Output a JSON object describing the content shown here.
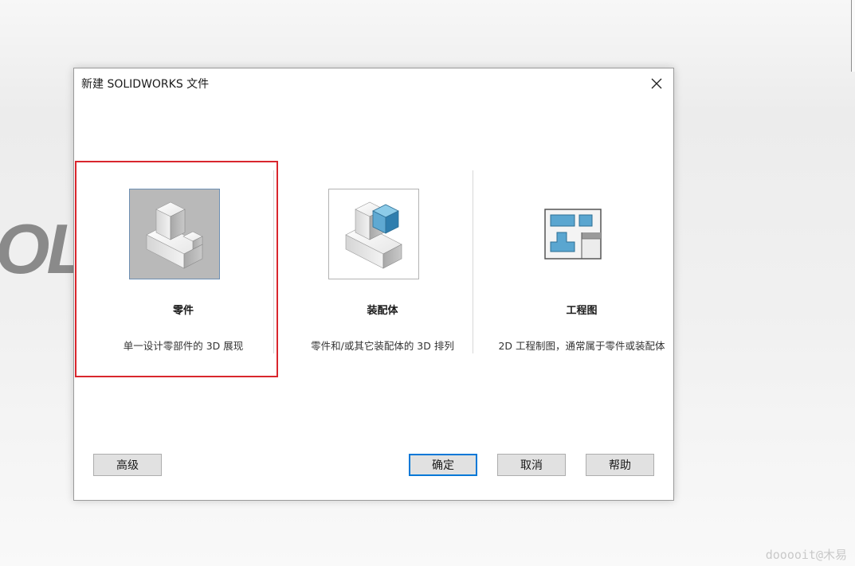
{
  "background": {
    "logo_text": "OL",
    "watermark": "dooooit@木易"
  },
  "dialog": {
    "title": "新建 SOLIDWORKS 文件",
    "options": [
      {
        "label": "零件",
        "description": "单一设计零部件的 3D 展现",
        "selected": true,
        "icon": "part-icon"
      },
      {
        "label": "装配体",
        "description": "零件和/或其它装配体的 3D 排列",
        "selected": false,
        "icon": "assembly-icon"
      },
      {
        "label": "工程图",
        "description": "2D 工程制图，通常属于零件或装配体",
        "selected": false,
        "icon": "drawing-icon"
      }
    ],
    "buttons": {
      "advanced": "高级",
      "ok": "确定",
      "cancel": "取消",
      "help": "帮助"
    }
  },
  "colors": {
    "highlight": "#d9262d",
    "selected_tile_bg": "#b9b9b9",
    "focus_border": "#0078d7",
    "cube_blue": "#4f9ec9"
  }
}
